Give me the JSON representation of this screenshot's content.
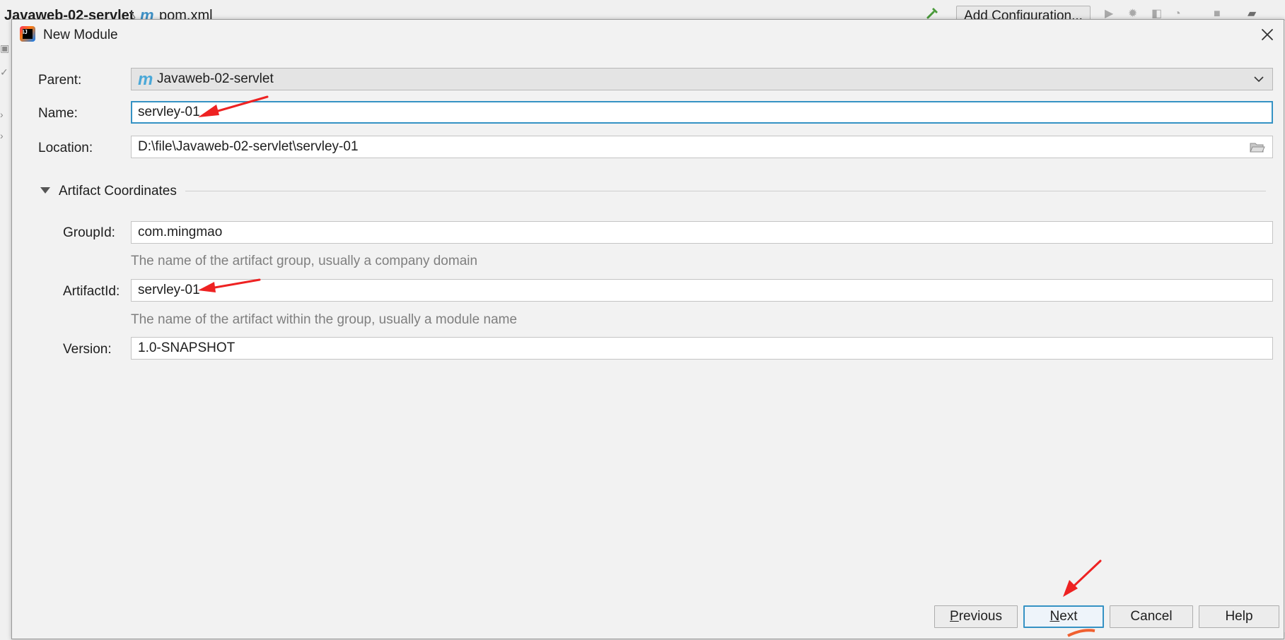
{
  "ide": {
    "breadcrumb_project": "Javaweb-02-servlet",
    "breadcrumb_separator": "〉",
    "breadcrumb_file_icon": "m",
    "breadcrumb_file": "pom.xml",
    "add_configuration_label": "Add Configuration...",
    "icons": [
      "hammer-icon",
      "run-icon",
      "debug-icon",
      "coverage-icon",
      "profile-icon",
      "stop-icon",
      "project-structure-icon"
    ]
  },
  "dialog": {
    "title": "New Module",
    "app_icon": "intellij-icon",
    "close_icon": "close-icon"
  },
  "form": {
    "parent_label": "Parent:",
    "parent_icon": "m",
    "parent_value": "Javaweb-02-servlet",
    "name_label": "Name:",
    "name_value": "servley-01",
    "location_label": "Location:",
    "location_value": "D:\\file\\Javaweb-02-servlet\\servley-01",
    "section_title": "Artifact Coordinates",
    "groupid_label": "GroupId:",
    "groupid_value": "com.mingmao",
    "groupid_hint": "The name of the artifact group, usually a company domain",
    "artifactid_label": "ArtifactId:",
    "artifactid_value": "servley-01",
    "artifactid_hint": "The name of the artifact within the group, usually a module name",
    "version_label": "Version:",
    "version_value": "1.0-SNAPSHOT"
  },
  "buttons": {
    "previous_mnemonic": "P",
    "previous_rest": "revious",
    "next_mnemonic": "N",
    "next_rest": "ext",
    "cancel": "Cancel",
    "help": "Help"
  },
  "colors": {
    "focus_border": "#3592c4",
    "annotation_arrow": "#ee2222",
    "dialog_background": "#f2f2f2"
  }
}
